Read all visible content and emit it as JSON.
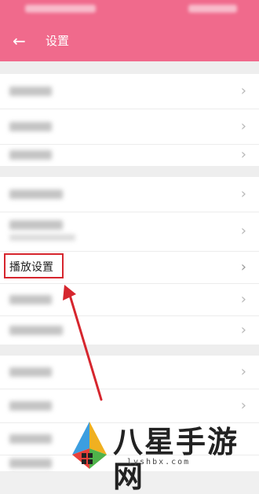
{
  "header": {
    "title": "设置",
    "back_icon": "arrow-left-icon"
  },
  "highlighted_item": {
    "label": "播放设置"
  },
  "watermark": {
    "brand": "八星手游网",
    "url": "lyshbx.com"
  },
  "colors": {
    "header": "#f06a8c",
    "highlight": "#d6262e"
  }
}
